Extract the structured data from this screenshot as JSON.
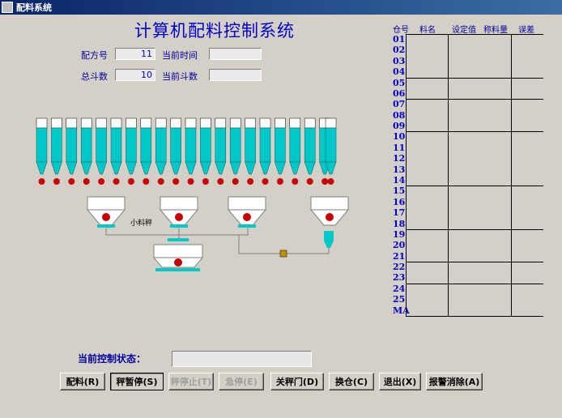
{
  "window": {
    "title": "配料系统"
  },
  "header": {
    "title": "计算机配料控制系统",
    "recipe_no_label": "配方号",
    "recipe_no_value": "11",
    "current_time_label": "当前时间",
    "current_time_value": "",
    "total_batches_label": "总斗数",
    "total_batches_value": "10",
    "current_batches_label": "当前斗数",
    "current_batches_value": ""
  },
  "table": {
    "columns": [
      "仓号",
      "料名",
      "设定值",
      "称料量",
      "误差"
    ],
    "rows": [
      "01",
      "02",
      "03",
      "04",
      "05",
      "06",
      "07",
      "08",
      "09",
      "10",
      "11",
      "12",
      "13",
      "14",
      "15",
      "16",
      "17",
      "18",
      "19",
      "20",
      "21",
      "22",
      "23",
      "24",
      "25",
      "MA"
    ]
  },
  "diagram": {
    "silo_count": 21,
    "weigh_hopper_count": 3,
    "mixer_label": "小料秤"
  },
  "status": {
    "label": "当前控制状态：",
    "value": ""
  },
  "buttons": [
    {
      "label": "配料(R)",
      "state": "normal"
    },
    {
      "label": "秤暂停(S)",
      "state": "pressed"
    },
    {
      "label": "秤停止(T)",
      "state": "disabled"
    },
    {
      "label": "急停(E)",
      "state": "disabled"
    },
    {
      "label": "关秤门(D)",
      "state": "normal"
    },
    {
      "label": "换仓(C)",
      "state": "normal"
    },
    {
      "label": "退出(X)",
      "state": "normal"
    },
    {
      "label": "报警消除(A)",
      "state": "normal"
    }
  ],
  "colors": {
    "silo": "#00c8c8",
    "valve": "#c80000",
    "title": "#0000c8",
    "window_bg": "#d4d0c8"
  }
}
